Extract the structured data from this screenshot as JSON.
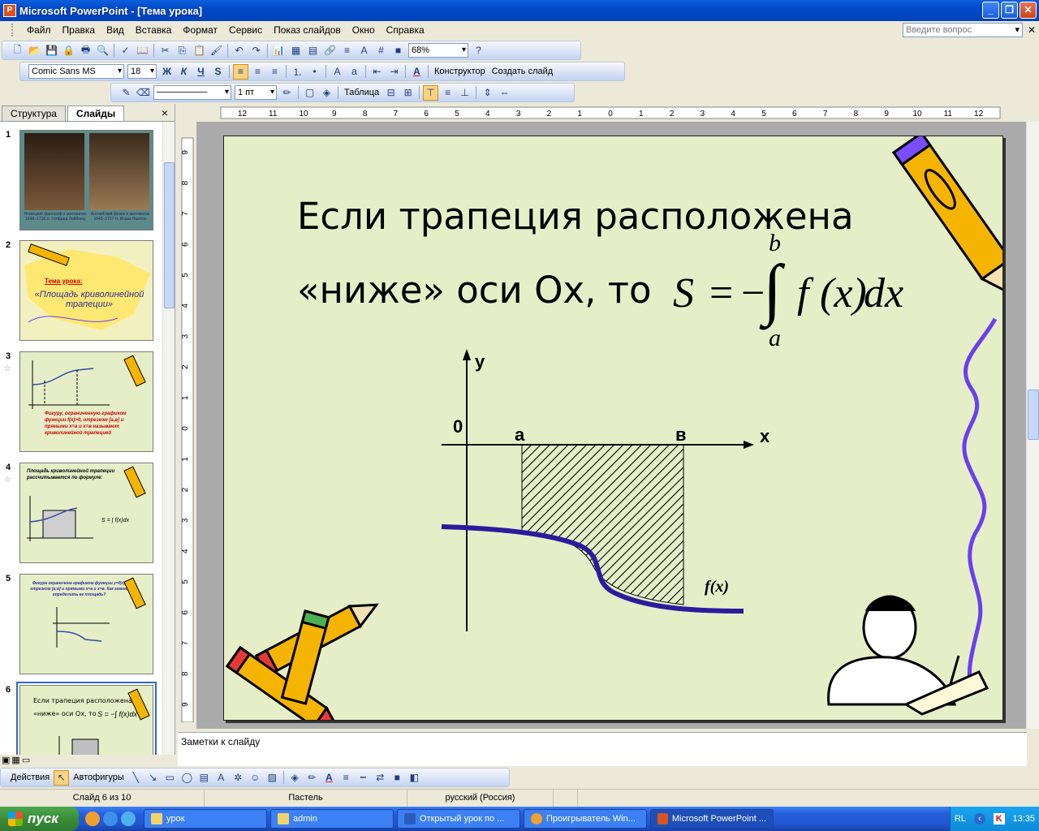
{
  "window": {
    "title": "Microsoft PowerPoint - [Тема урока]"
  },
  "menu": [
    "Файл",
    "Правка",
    "Вид",
    "Вставка",
    "Формат",
    "Сервис",
    "Показ слайдов",
    "Окно",
    "Справка"
  ],
  "help_placeholder": "Введите вопрос",
  "toolbar_standard": {
    "zoom": "68%"
  },
  "toolbar_formatting": {
    "font": "Comic Sans MS",
    "size": "18",
    "bold": "Ж",
    "italic": "К",
    "underline": "Ч",
    "shadow": "S",
    "design": "Конструктор",
    "new_slide": "Создать слайд"
  },
  "toolbar_tables": {
    "line_width": "1 пт",
    "table": "Таблица"
  },
  "pane": {
    "tab_outline": "Структура",
    "tab_slides": "Слайды",
    "close": "×"
  },
  "thumbs": [
    {
      "num": "1"
    },
    {
      "num": "2"
    },
    {
      "num": "3",
      "star": "☆"
    },
    {
      "num": "4",
      "star": "☆"
    },
    {
      "num": "5"
    },
    {
      "num": "6"
    }
  ],
  "thumb_texts": {
    "t1a": "Немецкий философ и математик 1646–1716 гг. Готфрид Лейбниц",
    "t1b": "Английский физик и математик 1643–1727 гг. Исаак Ньютон",
    "t2a": "Тема урока:",
    "t2b": "«Площадь криволинейной трапеции»",
    "t3": "Фигуру, ограниченную графиком функции f(x)>0, отрезком [a,в] и прямыми x=a и x=в называют криволинейной трапецией",
    "t4": "Площадь криволинейной трапеции рассчитывается по формуле:",
    "t5": "Фигура ограничена графиком функции y=f(x), отрезком [a;в] и прямыми x=a и x=в. Как можно определить ее площадь?",
    "t6a": "Если трапеция расположена",
    "t6b": "«ниже» оси Ox, то"
  },
  "slide": {
    "title_line1": "Если трапеция расположена",
    "title_line2": "«ниже» оси Ox, то",
    "formula": {
      "S": "S",
      "eq": "=",
      "minus": "−",
      "integral": "∫",
      "upper": "b",
      "lower": "a",
      "f": "f",
      "arg": "(x)",
      "dx": "dx"
    },
    "graph": {
      "y_label": "y",
      "x_label": "x",
      "origin": "0",
      "a_label": "a",
      "b_label": "в",
      "fx_label": "f(x)"
    }
  },
  "notes_placeholder": "Заметки к слайду",
  "draw_toolbar": {
    "actions": "Действия",
    "autoshapes": "Автофигуры"
  },
  "status": {
    "slide": "Слайд 6 из 10",
    "design": "Пастель",
    "lang": "русский (Россия)"
  },
  "taskbar": {
    "start": "пуск",
    "tasks": [
      "урок",
      "admin",
      "Открытый урок по ...",
      "Проигрыватель Win...",
      "Microsoft PowerPoint ..."
    ],
    "lang": "RL",
    "time": "13:35"
  },
  "colors": {
    "slide_bg": "#e6eec8",
    "curve": "#2e1a9c",
    "ribbon": "#6a3ff0",
    "pencil_body": "#f5b400"
  }
}
